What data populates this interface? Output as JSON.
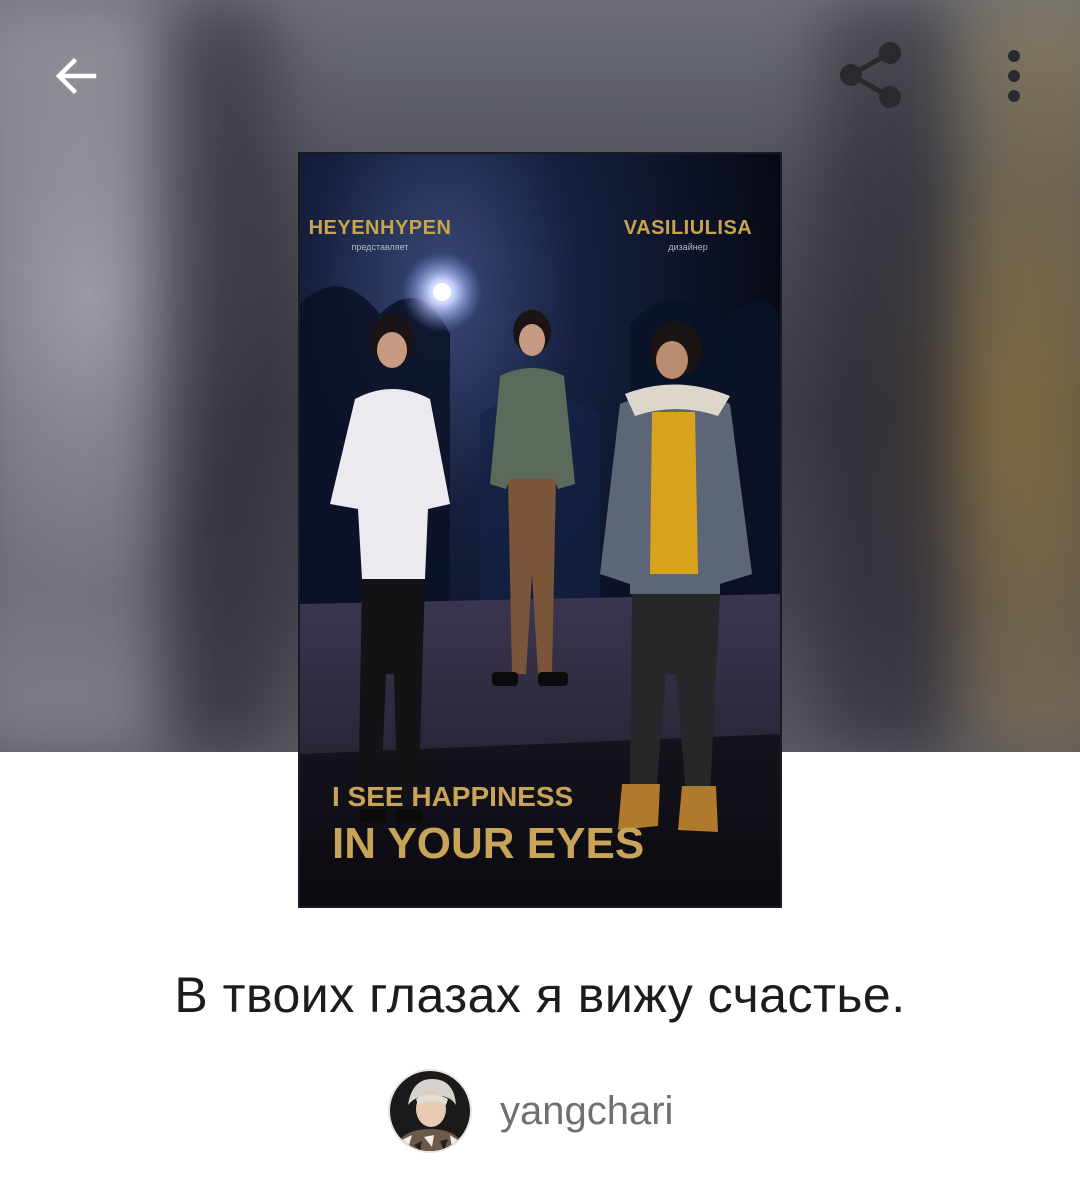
{
  "topbar": {
    "back_icon": "arrow-left-icon",
    "share_icon": "share-icon",
    "more_icon": "more-vertical-icon"
  },
  "cover": {
    "left_credit": "HEYENHYPEN",
    "left_credit_sub": "представляет",
    "right_credit": "VASILIULISA",
    "right_credit_sub": "дизайнер",
    "tagline": "I SEE HAPPINESS",
    "headline": "IN YOUR EYES",
    "accent_color": "#c9a44a"
  },
  "book": {
    "title": "В твоих глазах я вижу счастье."
  },
  "author": {
    "name": "yangchari"
  }
}
